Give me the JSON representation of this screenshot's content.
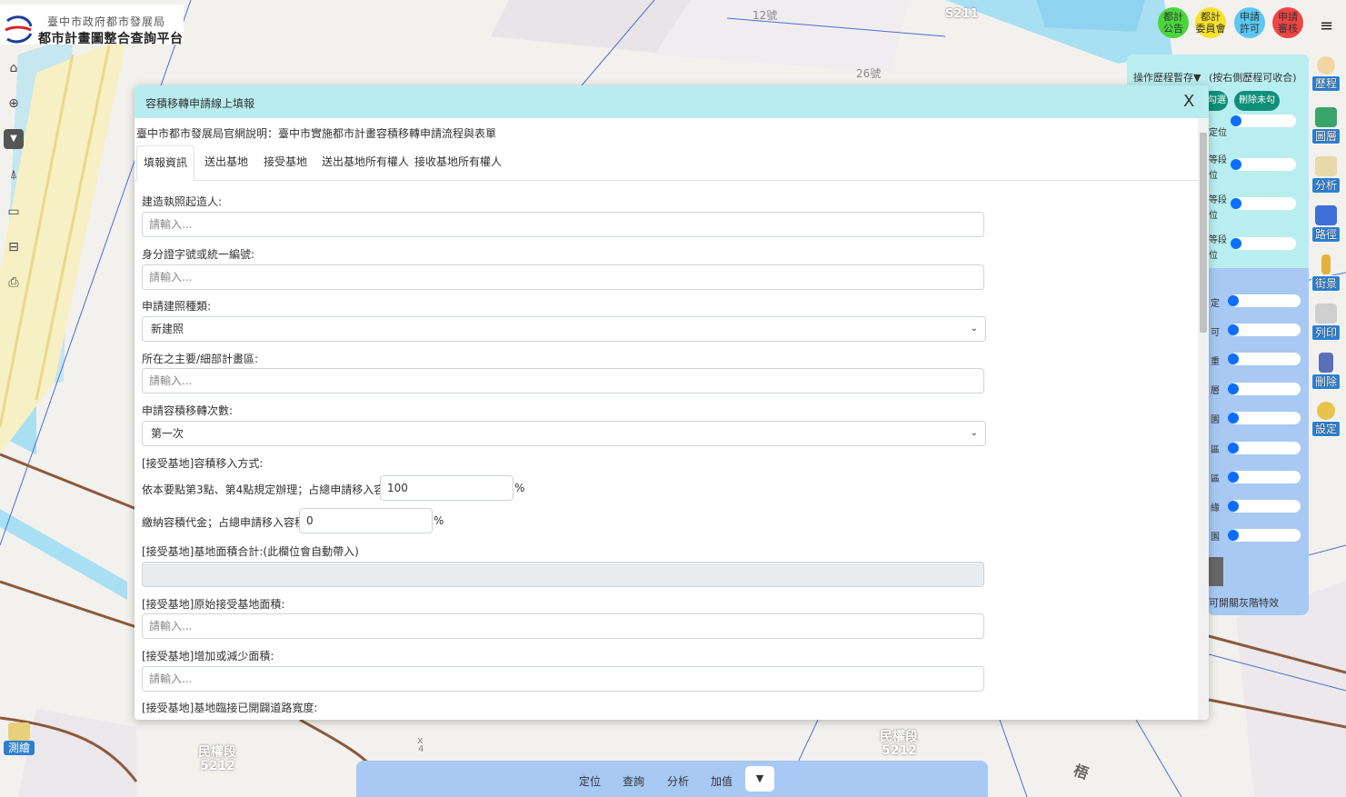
{
  "header": {
    "agency": "臺中市政府都市發展局",
    "platform": "都市計畫圖整合查詢平台"
  },
  "top_buttons": [
    {
      "line1": "都計",
      "line2": "公告",
      "color": "#49d63c"
    },
    {
      "line1": "都計",
      "line2": "委員會",
      "color": "#f7e12b"
    },
    {
      "line1": "申請",
      "line2": "許可",
      "color": "#5cc7f2"
    },
    {
      "line1": "申請",
      "line2": "審核",
      "color": "#f04545"
    }
  ],
  "menu_icon": "≡",
  "right_toolbar": [
    "歷程",
    "圖層",
    "分析",
    "路徑",
    "街景",
    "列印",
    "刪除",
    "設定"
  ],
  "history": {
    "title": "操作歷程暫存▼",
    "hint": "(按右側歷程可收合)",
    "btn1": "勾選",
    "btn2": "刪除未勾",
    "rows": [
      "定位",
      "等段",
      "位",
      "等段",
      "位",
      "等段",
      "位",
      "定",
      "可",
      "重",
      "層",
      "園",
      "區",
      "區",
      "緣",
      "園"
    ],
    "footer": "可開關灰階特效"
  },
  "map_labels": {
    "l1": "12號",
    "l2": "26號",
    "l3": "S211",
    "l4": "民權段",
    "l5": "5212",
    "l6": "民權段",
    "l7": "5212",
    "l8": "梧",
    "l9": "x",
    "l10": "4"
  },
  "dialog": {
    "title": "容積移轉申請線上填報",
    "close": "X",
    "notice": "臺中市都市發展局官網說明：臺中市實施都市計畫容積移轉申請流程與表單",
    "tabs": [
      "填報資訊",
      "送出基地",
      "接受基地",
      "送出基地所有權人",
      "接收基地所有權人"
    ],
    "fields": {
      "f1_label": "建造執照起造人:",
      "f1_placeholder": "請輸入...",
      "f2_label": "身分證字號或統一編號:",
      "f2_placeholder": "請輸入...",
      "f3_label": "申請建照種類:",
      "f3_value": "新建照",
      "f4_label": "所在之主要/細部計畫區:",
      "f4_placeholder": "請輸入...",
      "f5_label": "申請容積移轉次數:",
      "f5_value": "第一次",
      "f6_label": "[接受基地]容積移入方式:",
      "f6a_text": "依本要點第3點、第4點規定辦理；占總申請移入容積之",
      "f6a_value": "100",
      "f6a_unit": "%",
      "f6b_text": "繳納容積代金；占總申請移入容積之",
      "f6b_value": "0",
      "f6b_unit": "%",
      "f7_label": "[接受基地]基地面積合計:(此欄位會自動帶入)",
      "f8_label": "[接受基地]原始接受基地面積:",
      "f8_placeholder": "請輸入...",
      "f9_label": "[接受基地]增加或減少面積:",
      "f9_placeholder": "請輸入...",
      "f10_label": "[接受基地]基地臨接已開闢道路寬度:"
    }
  },
  "bottom_toolbar": {
    "items": [
      "定位",
      "查詢",
      "分析",
      "加值"
    ],
    "toggle": "▼"
  },
  "draw_button": "測繪"
}
